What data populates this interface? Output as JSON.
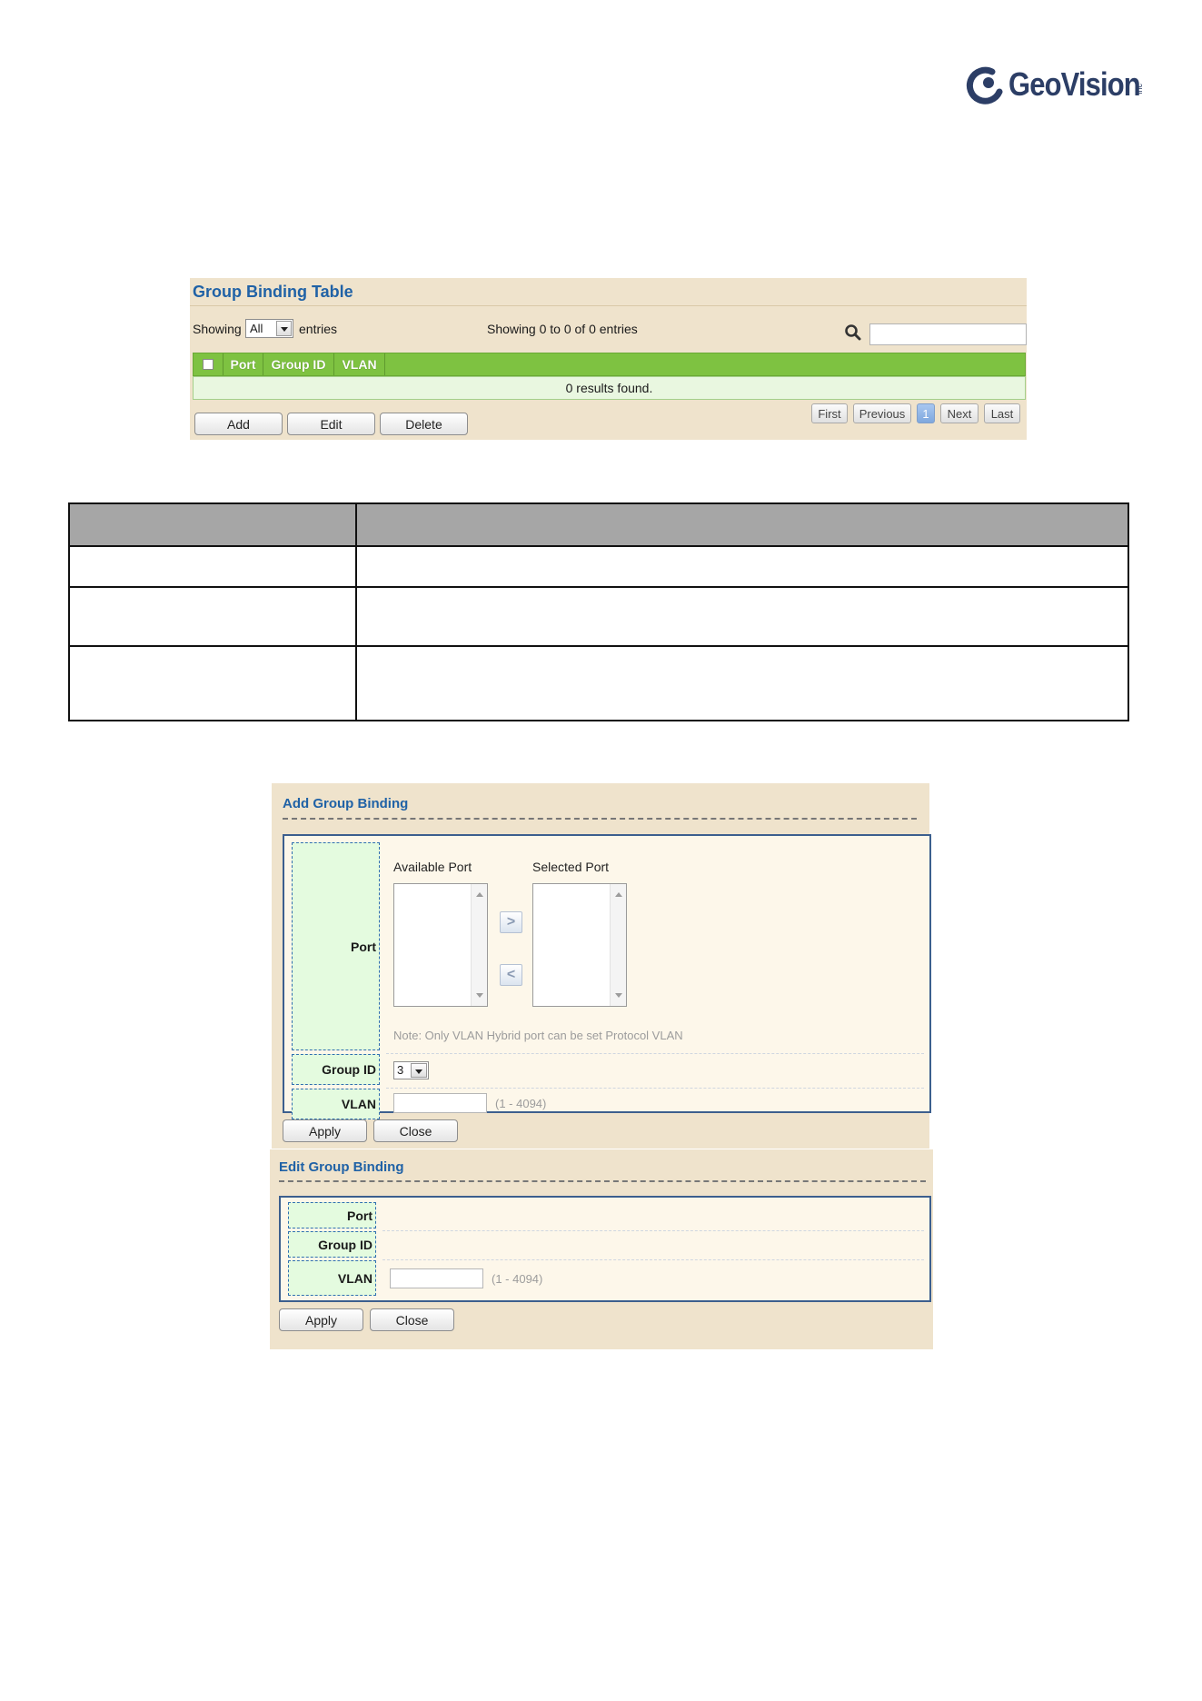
{
  "logo": {
    "brand": "GeoVision",
    "suffix": "inc"
  },
  "colors": {
    "panel_bg": "#efe3cc",
    "table_header": "#7ec241",
    "title_blue": "#2062a6",
    "label_cell": "#e4fbdf"
  },
  "group_binding_table": {
    "title": "Group Binding Table",
    "showing_label": "Showing",
    "entries_value": "All",
    "entries_label": "entries",
    "summary": "Showing 0 to 0 of 0 entries",
    "search_value": "",
    "columns": [
      "Port",
      "Group ID",
      "VLAN"
    ],
    "empty_message": "0 results found.",
    "buttons": {
      "add": "Add",
      "edit": "Edit",
      "delete": "Delete"
    },
    "pagination": {
      "first": "First",
      "previous": "Previous",
      "page": "1",
      "next": "Next",
      "last": "Last"
    }
  },
  "description_table": {
    "headers": [
      "",
      ""
    ],
    "rows": [
      [
        "",
        ""
      ],
      [
        "",
        ""
      ],
      [
        "",
        ""
      ]
    ]
  },
  "add_group_binding": {
    "title": "Add Group Binding",
    "port_label": "Port",
    "available_port": "Available Port",
    "selected_port": "Selected Port",
    "move_right": ">",
    "move_left": "<",
    "note": "Note: Only VLAN Hybrid port can be set Protocol VLAN",
    "group_id_label": "Group ID",
    "group_id_value": "3",
    "vlan_label": "VLAN",
    "vlan_value": "",
    "vlan_hint": "(1 - 4094)",
    "apply": "Apply",
    "close": "Close"
  },
  "edit_group_binding": {
    "title": "Edit Group Binding",
    "port_label": "Port",
    "group_id_label": "Group ID",
    "vlan_label": "VLAN",
    "vlan_value": "",
    "vlan_hint": "(1 - 4094)",
    "apply": "Apply",
    "close": "Close"
  }
}
